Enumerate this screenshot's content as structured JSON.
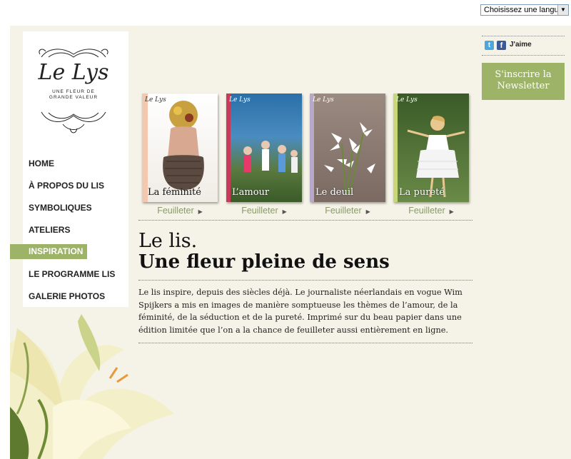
{
  "language": {
    "selected": "Choisissez une langue"
  },
  "logo": {
    "name": "Le Lys",
    "tagline_1": "UNE FLEUR DE",
    "tagline_2": "GRANDE VALEUR"
  },
  "nav": {
    "items": [
      {
        "label": "HOME"
      },
      {
        "label": "À PROPOS DU LIS"
      },
      {
        "label": "SYMBOLIQUES"
      },
      {
        "label": "ATELIERS"
      },
      {
        "label": "INSPIRATION"
      },
      {
        "label": "LE PROGRAMME LIS"
      },
      {
        "label": "GALERIE PHOTOS"
      }
    ],
    "active": "INSPIRATION"
  },
  "books": [
    {
      "title": "La féminité",
      "mini": "Le Lys",
      "action": "Feuilleter"
    },
    {
      "title": "L’amour",
      "mini": "Le Lys",
      "action": "Feuilleter"
    },
    {
      "title": "Le deuil",
      "mini": "Le Lys",
      "action": "Feuilleter"
    },
    {
      "title": "La pureté",
      "mini": "Le Lys",
      "action": "Feuilleter"
    }
  ],
  "main": {
    "heading_1": "Le lis.",
    "heading_2": "Une fleur pleine de sens",
    "body": "Le lis inspire, depuis des siècles déjà. Le journaliste néerlandais en vogue Wim Spijkers a mis en images de manière somptueuse les thèmes de l’amour, de la féminité, de la séduction et de la pureté. Imprimé sur du beau papier dans une édition limitée que l’on a la chance de feuilleter aussi entièrement en ligne."
  },
  "social": {
    "twitter": "t",
    "facebook": "f",
    "like": "J'aime"
  },
  "newsletter": {
    "line_1": "S'inscrire la",
    "line_2": "Newsletter"
  },
  "colors": {
    "accent_green": "#9db368",
    "background": "#f5f2e7",
    "link_green": "#8a9a6a"
  }
}
